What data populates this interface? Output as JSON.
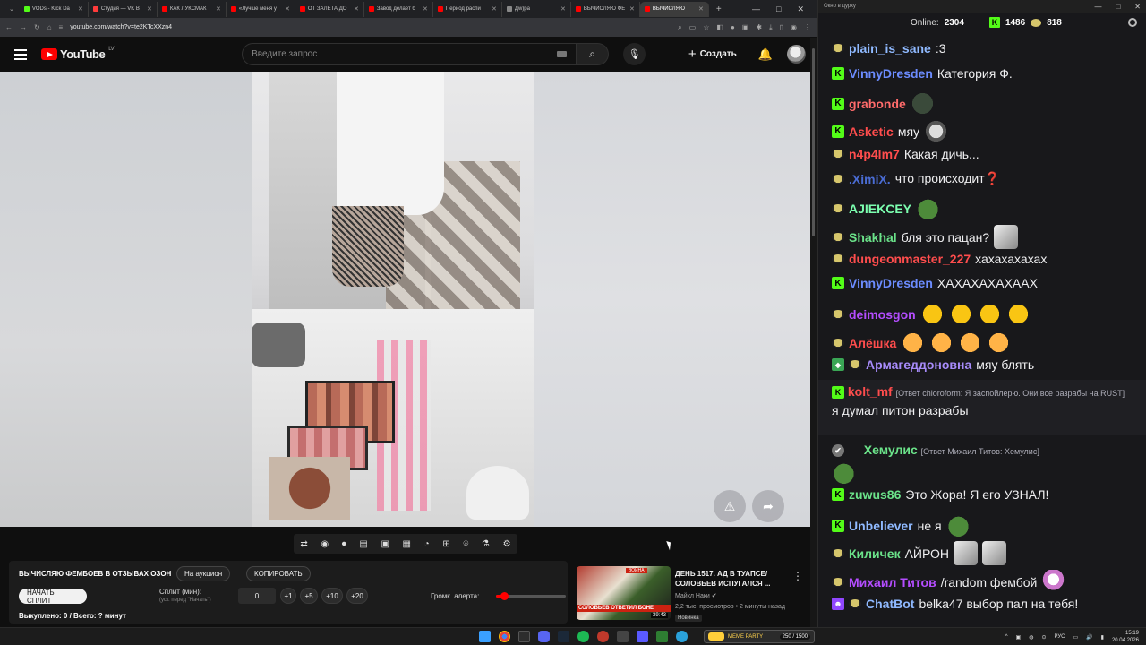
{
  "browser": {
    "tabs": [
      {
        "label": "VODs - Kick Da",
        "color": "#53fc18"
      },
      {
        "label": "Студия — VK B",
        "color": "#ff3b3b"
      },
      {
        "label": "КАК ЛУКСМАК",
        "color": "#ff0000"
      },
      {
        "label": "«Лучше меня у",
        "color": "#ff0000"
      },
      {
        "label": "ОТ ЗАЛЕТА ДО",
        "color": "#ff0000"
      },
      {
        "label": "Завод делает б",
        "color": "#ff0000"
      },
      {
        "label": "Период распи",
        "color": "#ff0000"
      },
      {
        "label": "Дw)ра",
        "color": "#888888"
      },
      {
        "label": "ВЫЧИСЛЯЮ ФЕ",
        "color": "#ff0000"
      },
      {
        "label": "ВЫЧИСЛЯЮ",
        "color": "#ff0000",
        "active": true
      }
    ],
    "url": "youtube.com/watch?v=te2KTcXXzn4"
  },
  "youtube": {
    "logo_text": "YouTube",
    "region": "LV",
    "search_placeholder": "Введите запрос",
    "create_label": "Создать"
  },
  "panel": {
    "title": "ВЫЧИСЛЯЮ ФЕМБОЕВ В ОТЗЫВАХ ОЗОН",
    "auction_btn": "На аукцион",
    "copy_btn": "КОПИРОВАТЬ",
    "start_split_btn": "НАЧАТЬ СПЛИТ",
    "split_label": "Сплит (мин):",
    "split_hint": "(уст. перед \"Начать\")",
    "split_value": "0",
    "quick_add": [
      "+1",
      "+5",
      "+10",
      "+20"
    ],
    "volume_label": "Громк. алерта:",
    "volume_level": 0.12,
    "stats": "Выкуплено: 0 / Всего: ? минут"
  },
  "recommended": {
    "title": "ДЕНЬ 1517. АД В ТУАПСЕ/ СОЛОВЬЕВ ИСПУГАЛСЯ ...",
    "channel": "Майкл Наки",
    "meta": "2,2 тыс. просмотров • 2 минуты назад",
    "badge": "Новинка",
    "duration": "39:43",
    "thumb_caption": "СОЛОВЬЕВ ОТВЕТИЛ БОНЕ",
    "thumb_tag": "ВОЙНА"
  },
  "chat": {
    "window_title": "Окно в дурку",
    "online_label": "Online:",
    "online_count": "2304",
    "kick_count": "1486",
    "other_count": "818",
    "messages": [
      {
        "badge": "pepe",
        "user": "plain_is_sane",
        "color": "#8fb9ff",
        "text": ":3"
      },
      {
        "badge": "k",
        "user": "VinnyDresden",
        "color": "#6c8cff",
        "text": "Категория Ф."
      },
      {
        "badge": "k",
        "user": "grabonde",
        "color": "#ff6b6b",
        "text": ""
      },
      {
        "badge": "k",
        "user": "Asketic",
        "color": "#ff4d4d",
        "text": "мяу"
      },
      {
        "badge": "pepe",
        "user": "n4p4lm7",
        "color": "#ff4d4d",
        "text": "Какая дичь..."
      },
      {
        "badge": "pepe",
        "user": ".XimiX.",
        "color": "#4a6cd4",
        "text": "что происходит❓"
      },
      {
        "badge": "pepe",
        "user": "AJIEKCEY",
        "color": "#7cffb0",
        "text": ""
      },
      {
        "badge": "pepe",
        "user": "Shakhal",
        "color": "#6be38a",
        "text": "бля это пацан?"
      },
      {
        "badge": "pepe",
        "user": "dungeonmaster_227",
        "color": "#ff4d4d",
        "text": "хахахахахах"
      },
      {
        "badge": "k",
        "user": "VinnyDresden",
        "color": "#6c8cff",
        "text": "ХАХАХАХАХААХ"
      },
      {
        "badge": "pepe",
        "user": "deimosgon",
        "color": "#b44dff",
        "text": ""
      },
      {
        "badge": "pepe",
        "user": "Алёшка",
        "color": "#ff4d4d",
        "text": ""
      },
      {
        "badge": "shield",
        "user": "Армагеддоновна",
        "color": "#a78bfa",
        "text": "мяу блять"
      },
      {
        "badge": "k",
        "user": "kolt_mf",
        "color": "#ff4d4d",
        "reply": "[Ответ chloroform: Я заспойлерю. Они все разрабы на RUST]",
        "text": "я думал питон разрабы"
      },
      {
        "badge": "grey",
        "user": "Хемулис",
        "color": "#6be38a",
        "reply": "[Ответ Михаил Титов: Хемулис]",
        "text": ""
      },
      {
        "badge": "k",
        "user": "zuwus86",
        "color": "#6be38a",
        "text": "Это Жора! Я его УЗНАЛ!"
      },
      {
        "badge": "k",
        "user": "Unbeliever",
        "color": "#8fb9ff",
        "text": "не я"
      },
      {
        "badge": "pepe",
        "user": "Киличек",
        "color": "#6be38a",
        "text": "АЙРОН"
      },
      {
        "badge": "pepe",
        "user": "Михаил Титов",
        "color": "#b44dff",
        "text": "/random фембой"
      },
      {
        "badge": "bot",
        "user": "ChatBot",
        "color": "#8fb9ff",
        "text": "belka47 выбор пал на тебя!"
      }
    ]
  },
  "taskbar": {
    "meme_label": "MEME PARTY",
    "meme_count": "250 / 1500",
    "lang": "РУС",
    "time": "15:19",
    "date": "20.04.2026"
  }
}
